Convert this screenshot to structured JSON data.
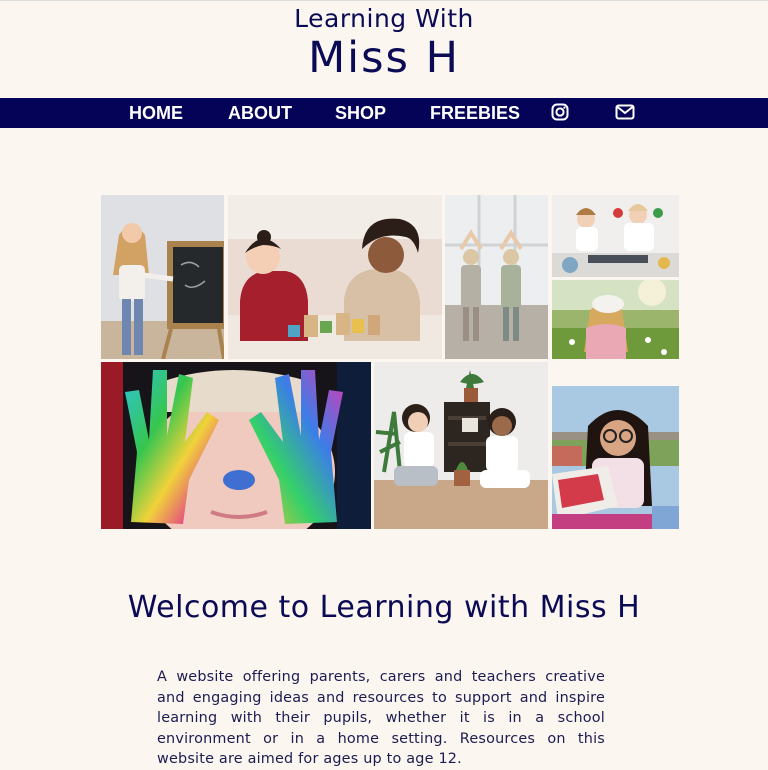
{
  "header": {
    "logo_line1": "Learning With",
    "logo_line2": "Miss H"
  },
  "nav": {
    "items": [
      {
        "label": "HOME"
      },
      {
        "label": "ABOUT"
      },
      {
        "label": "SHOP"
      },
      {
        "label": "FREEBIES"
      }
    ],
    "icons": [
      "instagram-icon",
      "mail-icon"
    ]
  },
  "gallery": {
    "photos": [
      "girl-at-chalkboard",
      "children-with-wooden-blocks",
      "girls-at-window",
      "children-painting-hands",
      "girl-in-field",
      "painted-hands",
      "children-with-plant",
      "girl-reading-book"
    ]
  },
  "main": {
    "welcome_heading": "Welcome to Learning with Miss H",
    "intro_text": "A website offering parents, carers and teachers creative and engaging ideas and resources to support and inspire learning with their pupils, whether it is in a school environment or in a home setting. Resources on this website are aimed for ages up to age 12."
  },
  "colors": {
    "background": "#fbf6f0",
    "navy": "#050357",
    "text": "#0b0b55"
  }
}
